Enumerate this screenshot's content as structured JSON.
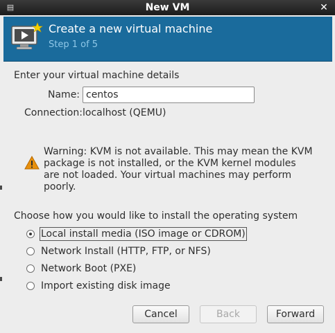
{
  "window": {
    "title": "New VM"
  },
  "header": {
    "title": "Create a new virtual machine",
    "step": "Step 1 of 5",
    "icon": "new-vm-icon"
  },
  "details": {
    "heading": "Enter your virtual machine details",
    "name_label": "Name:",
    "name_value": "centos",
    "connection_label": "Connection:",
    "connection_value": "localhost (QEMU)"
  },
  "warning": {
    "icon": "warning-icon",
    "line1": "Warning: KVM is not available. This may mean the KVM",
    "line2": "package is not installed, or the KVM kernel modules",
    "line3": "are not loaded. Your virtual machines may perform poorly."
  },
  "install": {
    "heading": "Choose how you would like to install the operating system",
    "options": [
      {
        "label": "Local install media (ISO image or CDROM)",
        "checked": true
      },
      {
        "label": "Network Install (HTTP, FTP, or NFS)",
        "checked": false
      },
      {
        "label": "Network Boot (PXE)",
        "checked": false
      },
      {
        "label": "Import existing disk image",
        "checked": false
      }
    ]
  },
  "buttons": {
    "cancel": "Cancel",
    "back": "Back",
    "forward": "Forward"
  },
  "colors": {
    "header_bg": "#1a6b9c",
    "step_text": "#8fc8e8",
    "titlebar": "#1c1c1c",
    "warning": "#e8900c"
  }
}
